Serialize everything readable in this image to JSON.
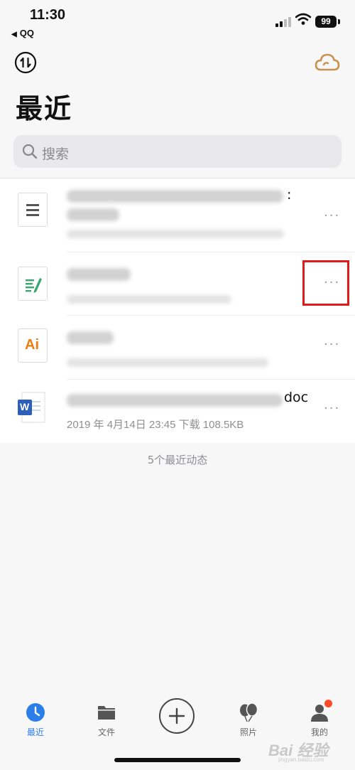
{
  "status_bar": {
    "time": "11:30",
    "back_app": "QQ",
    "battery": "99"
  },
  "header": {
    "title": "最近"
  },
  "search": {
    "placeholder": "搜索"
  },
  "files": [
    {
      "icon": "document-list-icon",
      "title_suffix": ":",
      "meta": ""
    },
    {
      "icon": "note-pencil-icon",
      "title_suffix": "",
      "meta": ""
    },
    {
      "icon": "illustrator-file-icon",
      "icon_text": "Ai",
      "title_suffix": "",
      "meta": ""
    },
    {
      "icon": "word-file-icon",
      "icon_text": "W",
      "title_suffix": "doc",
      "meta": "2019 年 4月14日 23:45 下载 108.5KB"
    }
  ],
  "more_label": "···",
  "count_note": "5个最近动态",
  "tabs": [
    {
      "label": "最近",
      "icon": "clock-icon",
      "active": true
    },
    {
      "label": "文件",
      "icon": "folder-icon",
      "active": false
    },
    {
      "label": "",
      "icon": "plus-icon",
      "active": false
    },
    {
      "label": "照片",
      "icon": "balloons-icon",
      "active": false
    },
    {
      "label": "我的",
      "icon": "user-icon",
      "active": false
    }
  ],
  "watermark": {
    "main": "Bai 经验",
    "sub": "jingyan.baidu.com"
  },
  "colors": {
    "accent": "#2b7de9",
    "highlight": "#e01b1b",
    "cloud": "#c8924e"
  }
}
